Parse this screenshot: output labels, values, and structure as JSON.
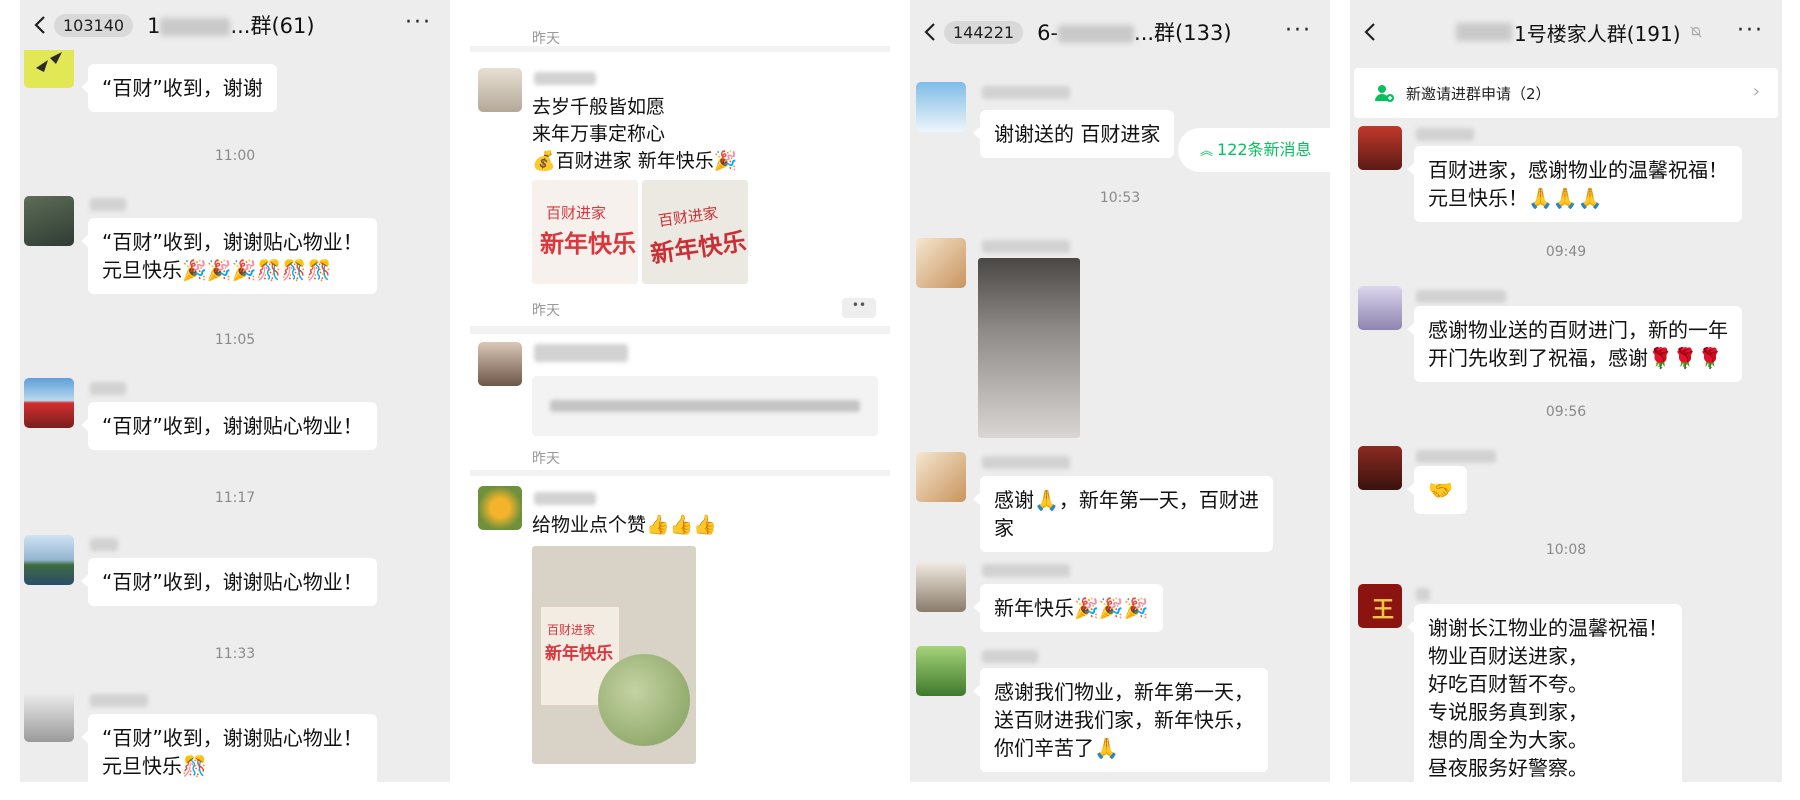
{
  "panel1": {
    "badge": "103140",
    "title_prefix": "1",
    "title_suffix": "...群(61)",
    "msg1": "“百财”收到，谢谢",
    "time1": "11:00",
    "msg2": "“百财”收到，谢谢贴心物业！\n元旦快乐🎉🎉🎉🎊🎊🎊",
    "time2": "11:05",
    "msg3": "“百财”收到，谢谢贴心物业！",
    "time3": "11:17",
    "msg4": "“百财”收到，谢谢贴心物业！",
    "time4": "11:33",
    "msg5": "“百财”收到，谢谢贴心物业！\n元旦快乐🎊"
  },
  "panel2": {
    "cap1": "昨天",
    "post1": "去岁千般皆如愿\n    来年万事定称心\n💰百财进家 新年快乐🎉",
    "bag_text_top": "百财进家",
    "bag_text_big": "新年快乐",
    "cap2": "昨天",
    "cap3": "昨天",
    "post3": "给物业点个赞👍👍👍",
    "more_dots": "••"
  },
  "panel3": {
    "badge": "144221",
    "title_prefix": "6-",
    "title_suffix": "...群(133)",
    "msg1": "谢谢送的 百财进家",
    "new_messages": "122条新消息",
    "new_icon": "double-up-arrow",
    "time1": "10:53",
    "msg2": "感谢🙏，新年第一天，百财进\n家",
    "msg3": "新年快乐🎉🎉🎉",
    "msg4": "感谢我们物业，新年第一天，\n送百财进我们家，新年快乐，\n你们辛苦了🙏"
  },
  "panel4": {
    "title": "1号楼家人群(191)",
    "invite": "新邀请进群申请（2）",
    "msg1": "百财进家，感谢物业的温馨祝福！\n元旦快乐！🙏🙏🙏",
    "time1": "09:49",
    "msg2": "感谢物业送的百财进门，新的一年\n开门先收到了祝福，感谢🌹🌹🌹",
    "time2": "09:56",
    "msg3": "🤝",
    "time3": "10:08",
    "msg4": "谢谢长江物业的温馨祝福！\n物业百财送进家，\n好吃百财暂不夸。\n专说服务真到家，\n想的周全为大家。\n昼夜服务好警察。\n大小事情得民心，"
  },
  "colors": {
    "wechat_green": "#07c160",
    "bg": "#ededed",
    "bag_red": "#d8373d"
  }
}
